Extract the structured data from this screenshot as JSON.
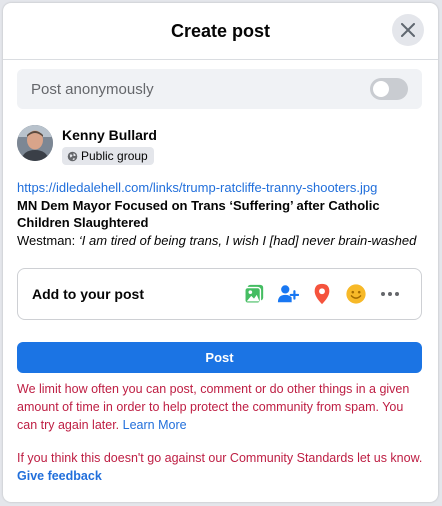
{
  "dialog": {
    "title": "Create post",
    "close_icon": "close-icon"
  },
  "anonymous": {
    "label": "Post anonymously",
    "toggle_on": false
  },
  "author": {
    "name": "Kenny Bullard",
    "badge_icon": "globe-icon",
    "badge_label": "Public group"
  },
  "post": {
    "link": "https://idledalehell.com/links/trump-ratcliffe-tranny-shooters.jpg",
    "headline": "MN Dem Mayor Focused on Trans ‘Suffering’ after Catholic Children Slaughtered",
    "quote_prefix": "Westman:",
    "quote_text": "‘I am tired of being trans, I wish I [had] never brain-washed"
  },
  "add_to_post": {
    "label": "Add to your post",
    "icons": [
      "photo-video-icon",
      "tag-people-icon",
      "location-icon",
      "feeling-icon",
      "more-icon"
    ],
    "colors": {
      "photo": "#45bd62",
      "tag": "#1877f2",
      "location": "#f5533d",
      "feeling": "#f7b928",
      "more": "#65676b"
    }
  },
  "post_button": {
    "label": "Post",
    "color": "#1b74e4"
  },
  "warning": {
    "text": "We limit how often you can post, comment or do other things in a given amount of time in order to help protect the community from spam. You can try again later.",
    "link": "Learn More",
    "color": "#be1e43"
  },
  "feedback": {
    "text": "If you think this doesn't go against our Community Standards let us know.",
    "link": "Give feedback"
  }
}
